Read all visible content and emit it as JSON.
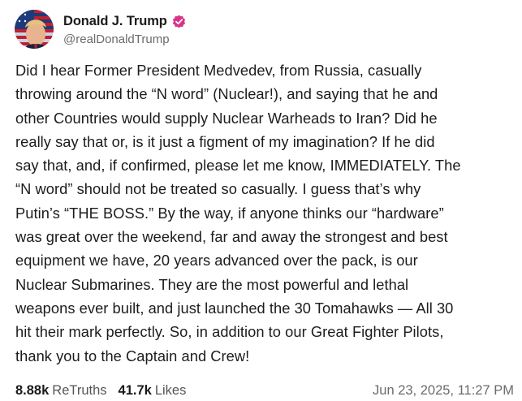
{
  "author": {
    "display_name": "Donald J. Trump",
    "handle": "@realDonaldTrump",
    "verified_icon": "verified-badge-icon",
    "badge_color": "#d9338a"
  },
  "post": {
    "lines": [
      "Did I hear Former President Medvedev, from Russia, casually",
      "throwing around the “N word” (Nuclear!), and saying that he and",
      "other Countries would supply Nuclear Warheads to Iran? Did he",
      "really say that or, is it just a figment of my imagination? If he did",
      "say that, and, if confirmed, please let me know, IMMEDIATELY. The",
      "“N word” should not be treated so casually. I guess that’s why",
      "Putin’s “THE BOSS.” By the way, if anyone thinks our “hardware”",
      "was great over the weekend, far and away the strongest and best",
      "equipment we have, 20 years advanced over the pack, is our",
      "Nuclear Submarines. They are the most powerful and lethal",
      "weapons ever built, and just launched the 30 Tomahawks — All 30",
      "hit their mark perfectly. So, in addition to our Great Fighter Pilots,",
      "thank you to the Captain and Crew!"
    ]
  },
  "stats": {
    "retruths_count": "8.88k",
    "retruths_label": "ReTruths",
    "likes_count": "41.7k",
    "likes_label": "Likes"
  },
  "timestamp": "Jun 23, 2025, 11:27 PM"
}
